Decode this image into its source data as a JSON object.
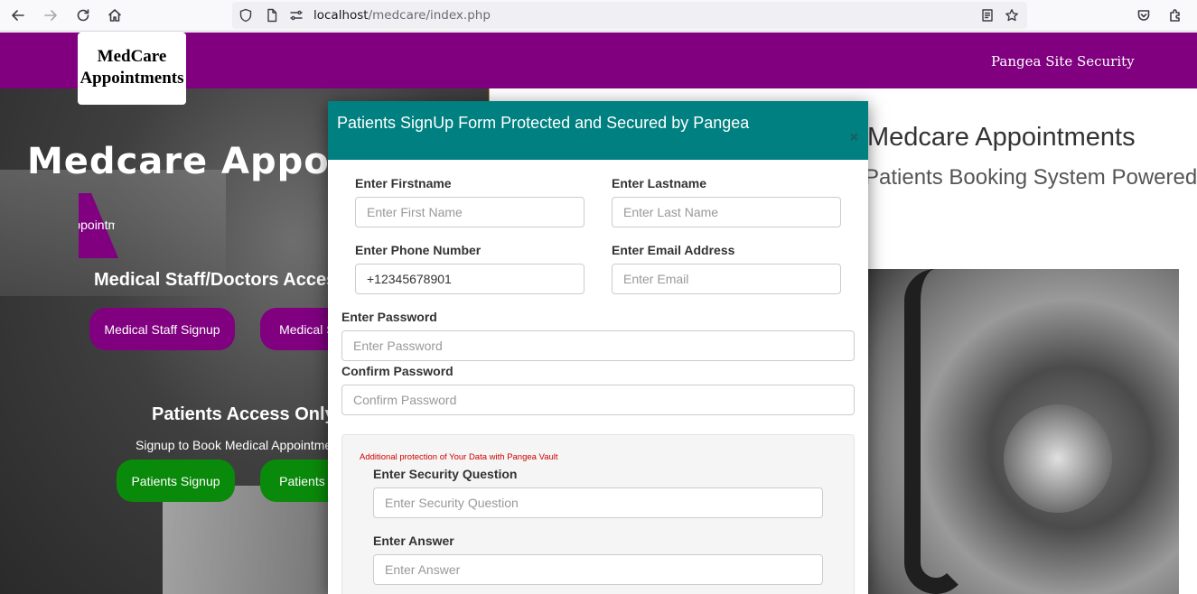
{
  "browser": {
    "url_host": "localhost",
    "url_path": "/medcare/index.php"
  },
  "header": {
    "logo_line1": "MedCare",
    "logo_line2": "Appointments",
    "nav_link": "Pangea Site Security"
  },
  "hero": {
    "title": "Medcare Appointments",
    "tab_label": "Appointments"
  },
  "staff": {
    "title": "Medical Staff/Doctors Access",
    "signup_label": "Medical Staff Signup",
    "login_label": "Medical Staff Login"
  },
  "patients": {
    "title": "Patients Access Only",
    "subtitle": "Signup to Book Medical Appointments",
    "signup_label": "Patients Signup",
    "login_label": "Patients Login"
  },
  "right_panel": {
    "title": "Medcare Appointments",
    "subtitle": "Patients Booking System Powered by"
  },
  "modal": {
    "title": "Patients SignUp Form Protected and Secured by Pangea",
    "close_symbol": "×",
    "fields": {
      "firstname_label": "Enter Firstname",
      "firstname_placeholder": "Enter First Name",
      "lastname_label": "Enter Lastname",
      "lastname_placeholder": "Enter Last Name",
      "phone_label": "Enter Phone Number",
      "phone_value": "+12345678901",
      "email_label": "Enter Email Address",
      "email_placeholder": "Enter Email",
      "password_label": "Enter Password",
      "password_placeholder": "Enter Password",
      "confirm_label": "Confirm Password",
      "confirm_placeholder": "Confirm Password"
    },
    "vault": {
      "note": "Additional protection of Your Data with Pangea Vault",
      "question_label": "Enter Security Question",
      "question_placeholder": "Enter Security Question",
      "answer_label": "Enter Answer",
      "answer_placeholder": "Enter Answer"
    }
  },
  "colors": {
    "brand_purple": "#800080",
    "modal_teal": "#008080",
    "patient_green": "#0a8a0a",
    "vault_note_red": "#d00000"
  },
  "icons": [
    "back-arrow-icon",
    "forward-arrow-icon",
    "reload-icon",
    "home-icon",
    "shield-icon",
    "page-icon",
    "permissions-icon",
    "reader-mode-icon",
    "bookmark-star-icon",
    "pocket-icon",
    "extensions-icon",
    "close-icon"
  ]
}
